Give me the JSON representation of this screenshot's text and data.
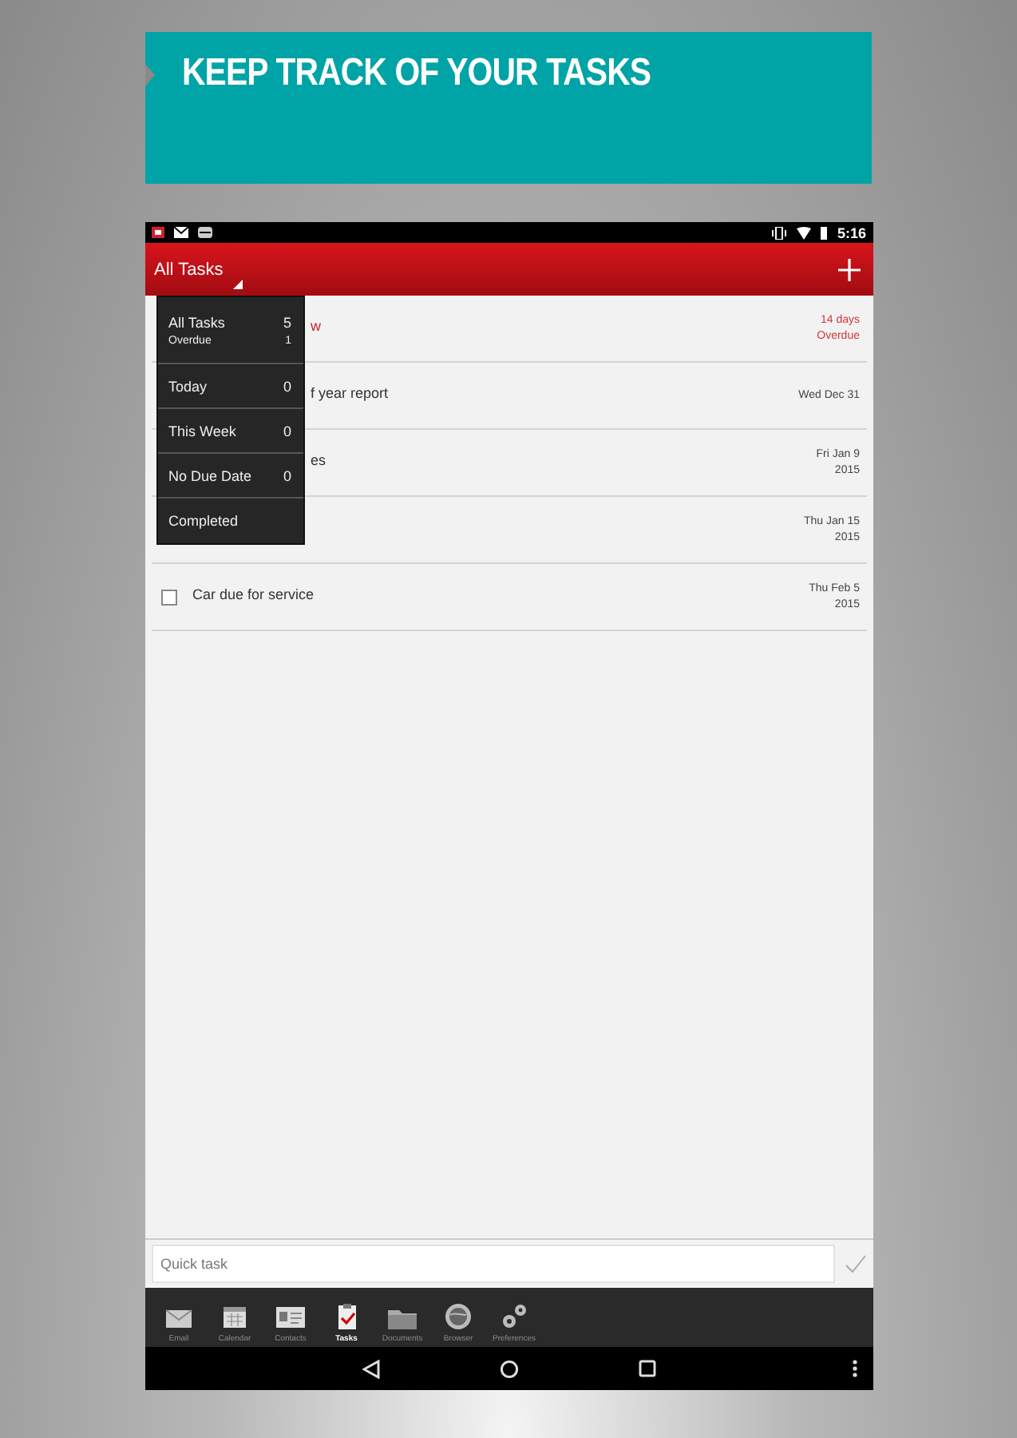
{
  "banner": {
    "title": "KEEP TRACK OF YOUR TASKS"
  },
  "status_bar": {
    "time": "5:16"
  },
  "toolbar": {
    "title": "All Tasks"
  },
  "tasks": [
    {
      "title": "w",
      "due": [
        "14 days",
        "Overdue"
      ],
      "overdue": true
    },
    {
      "title": "f year report",
      "due": [
        "Wed Dec 31"
      ],
      "overdue": false
    },
    {
      "title": "es",
      "due": [
        "Fri Jan 9",
        "2015"
      ],
      "overdue": false
    },
    {
      "due": [
        "Thu Jan 15",
        "2015"
      ],
      "overdue": false
    },
    {
      "title": "Car due for service",
      "due": [
        "Thu Feb 5",
        "2015"
      ],
      "overdue": false,
      "checked": false
    }
  ],
  "filter_menu": [
    {
      "label": "All Tasks",
      "count": "5",
      "sub_label": "Overdue",
      "sub_count": "1"
    },
    {
      "label": "Today",
      "count": "0"
    },
    {
      "label": "This Week",
      "count": "0"
    },
    {
      "label": "No Due Date",
      "count": "0"
    },
    {
      "label": "Completed"
    }
  ],
  "quick_task": {
    "placeholder": "Quick task"
  },
  "nav": [
    {
      "label": "Email",
      "kind": "email",
      "selected": false
    },
    {
      "label": "Calendar",
      "kind": "calendar",
      "selected": false
    },
    {
      "label": "Contacts",
      "kind": "contacts",
      "selected": false
    },
    {
      "label": "Tasks",
      "kind": "tasks",
      "selected": true
    },
    {
      "label": "Documents",
      "kind": "documents",
      "selected": false
    },
    {
      "label": "Browser",
      "kind": "browser",
      "selected": false
    },
    {
      "label": "Preferences",
      "kind": "preferences",
      "selected": false
    }
  ]
}
